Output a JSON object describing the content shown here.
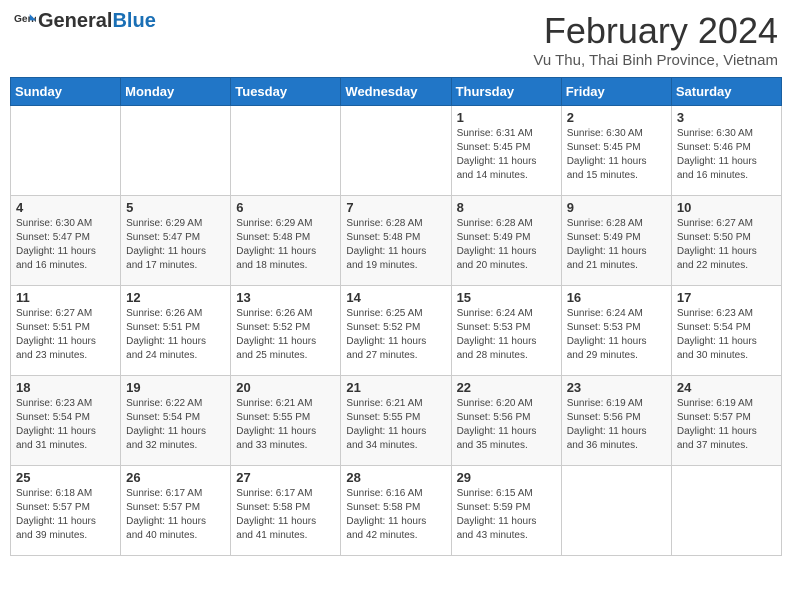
{
  "header": {
    "logo_general": "General",
    "logo_blue": "Blue",
    "title": "February 2024",
    "subtitle": "Vu Thu, Thai Binh Province, Vietnam"
  },
  "days_of_week": [
    "Sunday",
    "Monday",
    "Tuesday",
    "Wednesday",
    "Thursday",
    "Friday",
    "Saturday"
  ],
  "weeks": [
    [
      {
        "day": "",
        "info": ""
      },
      {
        "day": "",
        "info": ""
      },
      {
        "day": "",
        "info": ""
      },
      {
        "day": "",
        "info": ""
      },
      {
        "day": "1",
        "info": "Sunrise: 6:31 AM\nSunset: 5:45 PM\nDaylight: 11 hours and 14 minutes."
      },
      {
        "day": "2",
        "info": "Sunrise: 6:30 AM\nSunset: 5:45 PM\nDaylight: 11 hours and 15 minutes."
      },
      {
        "day": "3",
        "info": "Sunrise: 6:30 AM\nSunset: 5:46 PM\nDaylight: 11 hours and 16 minutes."
      }
    ],
    [
      {
        "day": "4",
        "info": "Sunrise: 6:30 AM\nSunset: 5:47 PM\nDaylight: 11 hours and 16 minutes."
      },
      {
        "day": "5",
        "info": "Sunrise: 6:29 AM\nSunset: 5:47 PM\nDaylight: 11 hours and 17 minutes."
      },
      {
        "day": "6",
        "info": "Sunrise: 6:29 AM\nSunset: 5:48 PM\nDaylight: 11 hours and 18 minutes."
      },
      {
        "day": "7",
        "info": "Sunrise: 6:28 AM\nSunset: 5:48 PM\nDaylight: 11 hours and 19 minutes."
      },
      {
        "day": "8",
        "info": "Sunrise: 6:28 AM\nSunset: 5:49 PM\nDaylight: 11 hours and 20 minutes."
      },
      {
        "day": "9",
        "info": "Sunrise: 6:28 AM\nSunset: 5:49 PM\nDaylight: 11 hours and 21 minutes."
      },
      {
        "day": "10",
        "info": "Sunrise: 6:27 AM\nSunset: 5:50 PM\nDaylight: 11 hours and 22 minutes."
      }
    ],
    [
      {
        "day": "11",
        "info": "Sunrise: 6:27 AM\nSunset: 5:51 PM\nDaylight: 11 hours and 23 minutes."
      },
      {
        "day": "12",
        "info": "Sunrise: 6:26 AM\nSunset: 5:51 PM\nDaylight: 11 hours and 24 minutes."
      },
      {
        "day": "13",
        "info": "Sunrise: 6:26 AM\nSunset: 5:52 PM\nDaylight: 11 hours and 25 minutes."
      },
      {
        "day": "14",
        "info": "Sunrise: 6:25 AM\nSunset: 5:52 PM\nDaylight: 11 hours and 27 minutes."
      },
      {
        "day": "15",
        "info": "Sunrise: 6:24 AM\nSunset: 5:53 PM\nDaylight: 11 hours and 28 minutes."
      },
      {
        "day": "16",
        "info": "Sunrise: 6:24 AM\nSunset: 5:53 PM\nDaylight: 11 hours and 29 minutes."
      },
      {
        "day": "17",
        "info": "Sunrise: 6:23 AM\nSunset: 5:54 PM\nDaylight: 11 hours and 30 minutes."
      }
    ],
    [
      {
        "day": "18",
        "info": "Sunrise: 6:23 AM\nSunset: 5:54 PM\nDaylight: 11 hours and 31 minutes."
      },
      {
        "day": "19",
        "info": "Sunrise: 6:22 AM\nSunset: 5:54 PM\nDaylight: 11 hours and 32 minutes."
      },
      {
        "day": "20",
        "info": "Sunrise: 6:21 AM\nSunset: 5:55 PM\nDaylight: 11 hours and 33 minutes."
      },
      {
        "day": "21",
        "info": "Sunrise: 6:21 AM\nSunset: 5:55 PM\nDaylight: 11 hours and 34 minutes."
      },
      {
        "day": "22",
        "info": "Sunrise: 6:20 AM\nSunset: 5:56 PM\nDaylight: 11 hours and 35 minutes."
      },
      {
        "day": "23",
        "info": "Sunrise: 6:19 AM\nSunset: 5:56 PM\nDaylight: 11 hours and 36 minutes."
      },
      {
        "day": "24",
        "info": "Sunrise: 6:19 AM\nSunset: 5:57 PM\nDaylight: 11 hours and 37 minutes."
      }
    ],
    [
      {
        "day": "25",
        "info": "Sunrise: 6:18 AM\nSunset: 5:57 PM\nDaylight: 11 hours and 39 minutes."
      },
      {
        "day": "26",
        "info": "Sunrise: 6:17 AM\nSunset: 5:57 PM\nDaylight: 11 hours and 40 minutes."
      },
      {
        "day": "27",
        "info": "Sunrise: 6:17 AM\nSunset: 5:58 PM\nDaylight: 11 hours and 41 minutes."
      },
      {
        "day": "28",
        "info": "Sunrise: 6:16 AM\nSunset: 5:58 PM\nDaylight: 11 hours and 42 minutes."
      },
      {
        "day": "29",
        "info": "Sunrise: 6:15 AM\nSunset: 5:59 PM\nDaylight: 11 hours and 43 minutes."
      },
      {
        "day": "",
        "info": ""
      },
      {
        "day": "",
        "info": ""
      }
    ]
  ]
}
